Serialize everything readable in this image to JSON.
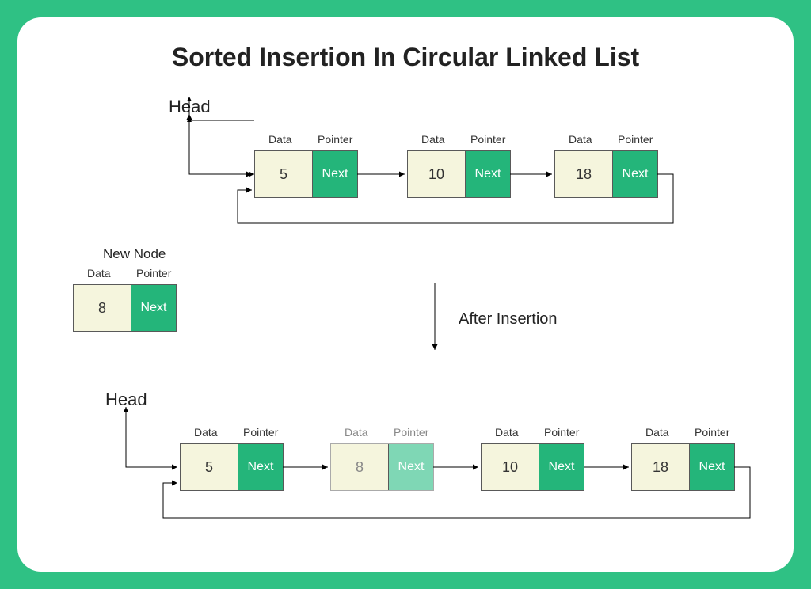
{
  "title": "Sorted Insertion In Circular Linked List",
  "labels": {
    "head": "Head",
    "data": "Data",
    "pointer": "Pointer",
    "next": "Next",
    "newNode": "New Node",
    "after": "After Insertion"
  },
  "before": {
    "nodes": [
      {
        "value": "5"
      },
      {
        "value": "10"
      },
      {
        "value": "18"
      }
    ]
  },
  "newNode": {
    "value": "8"
  },
  "afterList": {
    "nodes": [
      {
        "value": "5"
      },
      {
        "value": "8",
        "inserted": true
      },
      {
        "value": "10"
      },
      {
        "value": "18"
      }
    ]
  }
}
